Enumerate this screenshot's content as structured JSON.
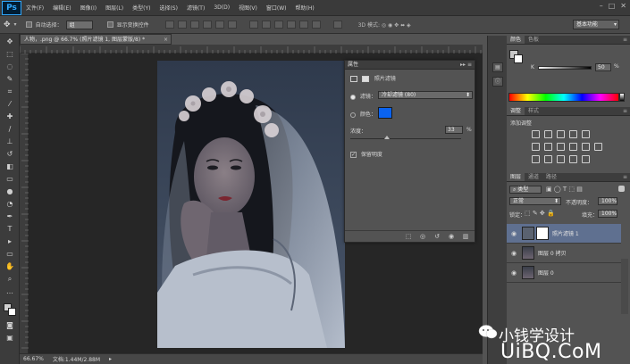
{
  "app": {
    "logo": "Ps"
  },
  "menu": [
    "文件(F)",
    "编辑(E)",
    "图像(I)",
    "图层(L)",
    "类型(Y)",
    "选择(S)",
    "滤镜(T)",
    "3D(D)",
    "视图(V)",
    "窗口(W)",
    "帮助(H)"
  ],
  "window_controls": [
    "–",
    "□",
    "✕"
  ],
  "options_bar": {
    "auto_select_label": "自动选择：",
    "auto_select_value": "组",
    "show_transform_label": "显示变换控件",
    "workspace": "基本功能"
  },
  "document": {
    "tab_title": "人物，.png @ 66.7% (照片滤镜 1, 图层蒙版/8) *",
    "close": "×",
    "zoom": "66.67%",
    "doc_size": "文档:1.44M/2.88M"
  },
  "properties": {
    "panel_title": "属性",
    "adjustment_name": "照片滤镜",
    "filter_label": "滤镜：",
    "filter_value": "冷却滤镜 (80)",
    "color_label": "颜色：",
    "color_hex": "#0a63f0",
    "density_label": "浓度：",
    "density_value": "33",
    "density_unit": "%",
    "density_fraction": 0.33,
    "preserve_luminosity": "保留明度"
  },
  "color_panel": {
    "tabs": [
      "颜色",
      "色板"
    ],
    "channel_label": "K",
    "channel_value": "50",
    "unit": "%"
  },
  "adjustments_panel": {
    "tabs": [
      "调整",
      "样式"
    ],
    "add_label": "添加调整"
  },
  "layers_panel": {
    "tabs": [
      "图层",
      "通道",
      "路径"
    ],
    "kind_value": "类型",
    "blend_mode": "正常",
    "opacity_label": "不透明度：",
    "opacity_value": "100%",
    "lock_label": "锁定：",
    "fill_label": "填充：",
    "fill_value": "100%",
    "layers": [
      {
        "name": "照片滤镜 1",
        "selected": true
      },
      {
        "name": "图层 0 拷贝",
        "selected": false
      },
      {
        "name": "图层 0",
        "selected": false
      }
    ]
  },
  "watermark": {
    "line1": "小钱学设计",
    "line2": "UiBQ.CoM"
  },
  "colors": {
    "accent_blue": "#0a63f0",
    "panel_bg": "#535353",
    "selected_layer": "#5f7090"
  }
}
